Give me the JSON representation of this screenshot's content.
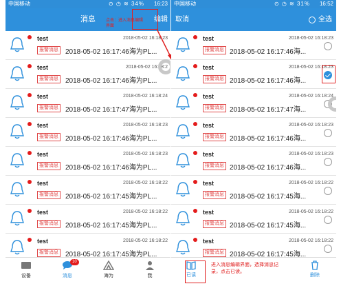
{
  "left": {
    "status": {
      "carrier": "中国移动",
      "time": "16:23",
      "icons": "⊙ ◷ ≋ 34%"
    },
    "nav": {
      "title": "消息",
      "edit": "编辑"
    },
    "annotation": "点击：进入消息编辑界面",
    "rows": [
      {
        "title": "test",
        "date": "2018-05-02 16:18:23",
        "badge": "报警消息",
        "content": "2018-05-02 16:17:46海为PL..."
      },
      {
        "title": "test",
        "date": "2018-05-02 16:18:2",
        "badge": "报警消息",
        "content": "2018-05-02 16:17:46海为PL..."
      },
      {
        "title": "test",
        "date": "2018-05-02 16:18:24",
        "badge": "报警消息",
        "content": "2018-05-02 16:17:47海为PL..."
      },
      {
        "title": "test",
        "date": "2018-05-02 16:18:23",
        "badge": "报警消息",
        "content": "2018-05-02 16:17:46海为PL..."
      },
      {
        "title": "test",
        "date": "2018-05-02 16:18:23",
        "badge": "报警消息",
        "content": "2018-05-02 16:17:46海为PL..."
      },
      {
        "title": "test",
        "date": "2018-05-02 16:18:22",
        "badge": "报警消息",
        "content": "2018-05-02 16:17:45海为PL..."
      },
      {
        "title": "test",
        "date": "2018-05-02 16:18:22",
        "badge": "报警消息",
        "content": "2018-05-02 16:17:45海为PL..."
      },
      {
        "title": "test",
        "date": "2018-05-02 16:18:22",
        "badge": "报警消息",
        "content": "2018-05-02 16:17:45海为PL..."
      }
    ],
    "tabs": [
      {
        "label": "设备"
      },
      {
        "label": "消息",
        "badge": "10"
      },
      {
        "label": "海为"
      },
      {
        "label": "我"
      }
    ]
  },
  "right": {
    "status": {
      "carrier": "中国移动",
      "time": "16:52",
      "icons": "⊙ ◷ ≋ 31%"
    },
    "nav": {
      "cancel": "取消",
      "select_all": "全选"
    },
    "rows": [
      {
        "title": "test",
        "date": "2018-05-02 16:18:23",
        "badge": "报警消息",
        "content": "2018-05-02 16:17:46海...",
        "checked": false
      },
      {
        "title": "test",
        "date": "2018-05-02 16:18:23",
        "badge": "报警消息",
        "content": "2018-05-02 16:17:46海...",
        "checked": true
      },
      {
        "title": "test",
        "date": "2018-05-02 16:18:24",
        "badge": "报警消息",
        "content": "2018-05-02 16:17:47海...",
        "checked": false
      },
      {
        "title": "test",
        "date": "2018-05-02 16:18:23",
        "badge": "报警消息",
        "content": "2018-05-02 16:17:46海...",
        "checked": false
      },
      {
        "title": "test",
        "date": "2018-05-02 16:18:23",
        "badge": "报警消息",
        "content": "2018-05-02 16:17:46海...",
        "checked": false
      },
      {
        "title": "test",
        "date": "2018-05-02 16:18:22",
        "badge": "报警消息",
        "content": "2018-05-02 16:17:45海...",
        "checked": false
      },
      {
        "title": "test",
        "date": "2018-05-02 16:18:22",
        "badge": "报警消息",
        "content": "2018-05-02 16:17:45海...",
        "checked": false
      },
      {
        "title": "test",
        "date": "2018-05-02 16:18:22",
        "badge": "报警消息",
        "content": "2018-05-02 16:17:45海...",
        "checked": false
      }
    ],
    "actions": {
      "read": "已读",
      "delete": "删除"
    },
    "note": "进入消息编辑界面，选择消息记录，点击已读。"
  },
  "colors": {
    "primary": "#2e90dc",
    "alert": "#e04848",
    "annotation": "#e02020"
  }
}
